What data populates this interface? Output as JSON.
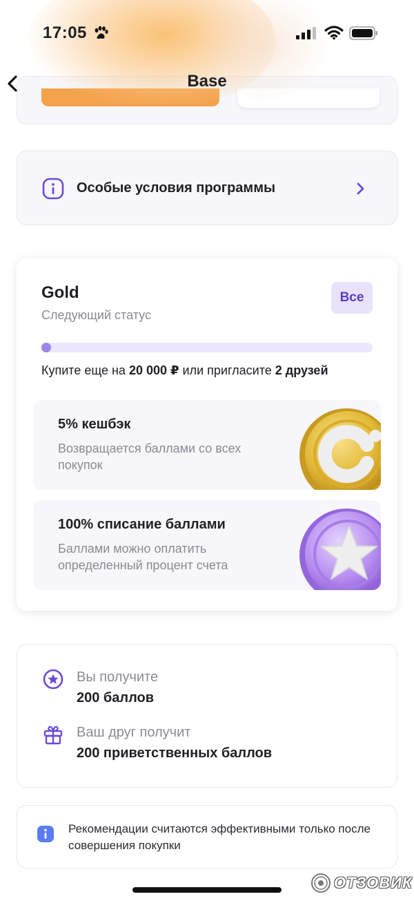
{
  "status_bar": {
    "time": "17:05"
  },
  "nav": {
    "title": "Base"
  },
  "conditions": {
    "label": "Особые условия программы"
  },
  "status_card": {
    "title": "Gold",
    "subtitle": "Следующий статус",
    "all_button": "Все",
    "progress_fraction": 0.03,
    "progress_text_prefix": "Купите еще на ",
    "progress_amount": "20 000 ₽",
    "progress_text_middle": " или пригласите ",
    "progress_friends": "2 друзей",
    "benefits": [
      {
        "title": "5% кешбэк",
        "description": "Возвращается баллами со всех покупок"
      },
      {
        "title": "100% списание баллами",
        "description": "Баллами можно оплатить определенный процент счета"
      }
    ]
  },
  "rewards": {
    "you_caption": "Вы получите",
    "you_value": "200 баллов",
    "friend_caption": "Ваш друг получит",
    "friend_value": "200 приветственных баллов"
  },
  "note": {
    "text": "Рекомендации считаются эффективными только после совершения покупки"
  },
  "watermark": {
    "text": "ОТЗОВИК"
  },
  "colors": {
    "accent": "#6a4bd6",
    "progress_track": "#ebe6fb",
    "all_button_bg": "#e8e3fa",
    "info_blue": "#5b7cf0"
  }
}
